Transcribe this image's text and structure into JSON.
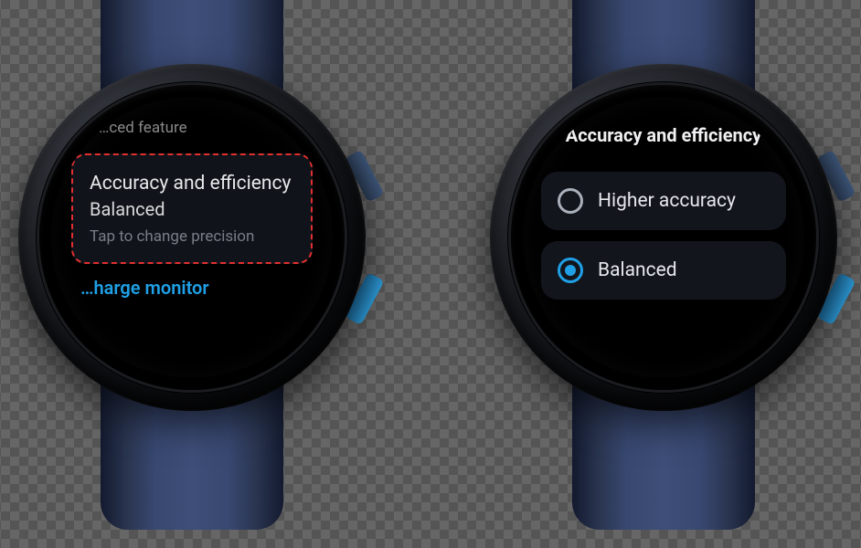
{
  "colors": {
    "accent": "#1fa0e6",
    "highlight_border": "#e03030"
  },
  "watch_left": {
    "section_header": "…ced feature",
    "card": {
      "title": "Accuracy and efficiency",
      "value": "Balanced",
      "hint": "Tap to change precision"
    },
    "link_label": "…harge monitor"
  },
  "watch_right": {
    "title": "Accuracy and efficiency",
    "options": [
      {
        "label": "Higher accuracy",
        "selected": false
      },
      {
        "label": "Balanced",
        "selected": true
      }
    ]
  }
}
